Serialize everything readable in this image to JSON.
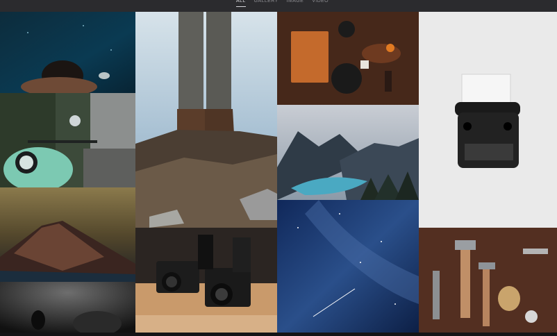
{
  "filters": [
    {
      "label": "ALL",
      "active": true
    },
    {
      "label": "GALLERY",
      "active": false
    },
    {
      "label": "IMAGE",
      "active": false
    },
    {
      "label": "VIDEO",
      "active": false
    }
  ],
  "gallery": {
    "tiles": [
      {
        "subject": "underwater-swimmer"
      },
      {
        "subject": "mint-scooter"
      },
      {
        "subject": "mountain-peak"
      },
      {
        "subject": "scuba-diver"
      },
      {
        "subject": "hiker-boots-on-rocks"
      },
      {
        "subject": "vintage-cameras-on-shelf"
      },
      {
        "subject": "notebook-and-spices-on-wood"
      },
      {
        "subject": "mountain-lake-valley"
      },
      {
        "subject": "starry-night-sky"
      },
      {
        "subject": "vintage-typewriter"
      },
      {
        "subject": "tools-on-wooden-table"
      }
    ]
  }
}
